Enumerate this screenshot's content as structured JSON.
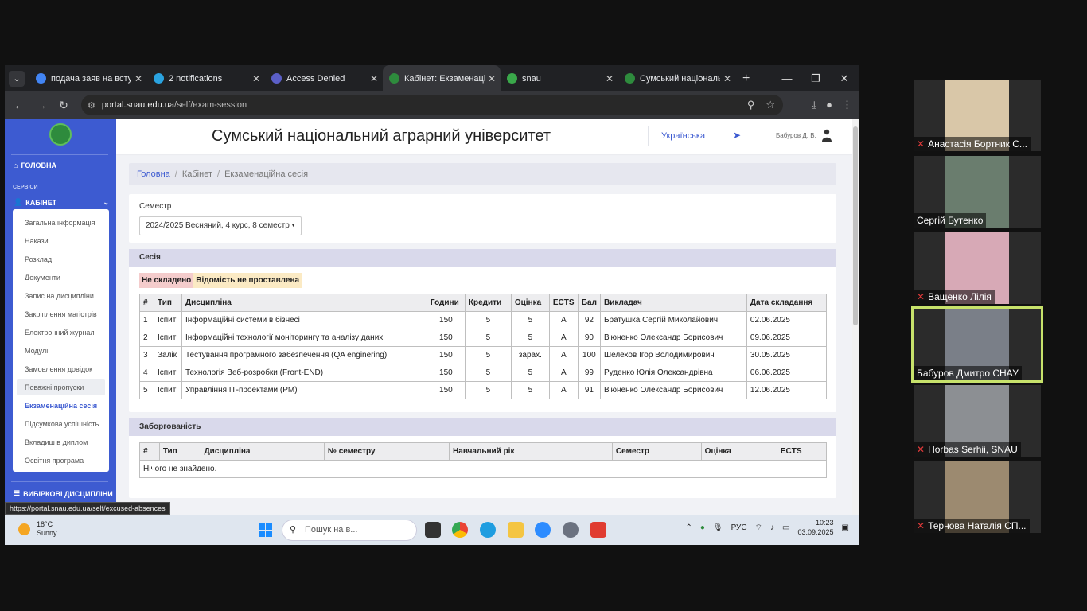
{
  "browser": {
    "tabs": [
      {
        "title": "подача заяв на вступ",
        "favicon": "google-icon",
        "color": "#4285f4"
      },
      {
        "title": "2 notifications",
        "favicon": "telegram-icon",
        "color": "#2aa3e0"
      },
      {
        "title": "Access Denied",
        "favicon": "page-icon",
        "color": "#5b5fc7"
      },
      {
        "title": "Кабінет: Екзаменацій",
        "favicon": "snau-icon",
        "color": "#2e8b3d",
        "active": true
      },
      {
        "title": "snau",
        "favicon": "snau-icon",
        "color": "#3aa84a"
      },
      {
        "title": "Сумський національн",
        "favicon": "snau-leaf-icon",
        "color": "#2e8b3d"
      }
    ],
    "url_host": "portal.snau.edu.ua",
    "url_path": "/self/exam-session",
    "status_url": "https://portal.snau.edu.ua/self/excused-absences"
  },
  "sidebar": {
    "home": "ГОЛОВНА",
    "section": "СЕРВІСИ",
    "cabinet": "КАБІНЕТ",
    "items": [
      "Загальна інформація",
      "Накази",
      "Розклад",
      "Документи",
      "Запис на дисципліни",
      "Закріплення магістрів",
      "Електронний журнал",
      "Модулі",
      "Замовлення довідок",
      "Поважні пропуски",
      "Екзаменаційна сесія",
      "Підсумкова успішність",
      "Вкладиш в диплом",
      "Освітня програма"
    ],
    "hover_index": 9,
    "active_index": 10,
    "electives": "ВИБІРКОВІ ДИСЦИПЛІНИ"
  },
  "header": {
    "title": "Сумський національний аграрний університет",
    "language": "Українська",
    "user": "Бабуров Д. В."
  },
  "breadcrumb": {
    "home": "Головна",
    "cabinet": "Кабінет",
    "current": "Екзаменаційна сесія"
  },
  "semester": {
    "label": "Семестр",
    "value": "2024/2025 Весняний, 4 курс, 8 семестр"
  },
  "session": {
    "title": "Сесія",
    "legend_failed": "Не складено",
    "legend_no_sheet": "Відомість не проставлена",
    "columns": [
      "#",
      "Тип",
      "Дисципліна",
      "Години",
      "Кредити",
      "Оцінка",
      "ECTS",
      "Бал",
      "Викладач",
      "Дата складання"
    ],
    "rows": [
      [
        "1",
        "Іспит",
        "Інформаційні системи в бізнесі",
        "150",
        "5",
        "5",
        "A",
        "92",
        "Братушка Сергій Миколайович",
        "02.06.2025"
      ],
      [
        "2",
        "Іспит",
        "Інформаційні технології моніторингу та аналізу даних",
        "150",
        "5",
        "5",
        "A",
        "90",
        "В'юненко Олександр Борисович",
        "09.06.2025"
      ],
      [
        "3",
        "Залік",
        "Тестування програмного забезпечення (QA enginering)",
        "150",
        "5",
        "зарах.",
        "A",
        "100",
        "Шелехов Ігор Володимирович",
        "30.05.2025"
      ],
      [
        "4",
        "Іспит",
        "Технологія Веб-розробки (Front-END)",
        "150",
        "5",
        "5",
        "A",
        "99",
        "Руденко Юлія Олександрівна",
        "06.06.2025"
      ],
      [
        "5",
        "Іспит",
        "Управління ІТ-проектами (PM)",
        "150",
        "5",
        "5",
        "A",
        "91",
        "В'юненко Олександр Борисович",
        "12.06.2025"
      ]
    ]
  },
  "debt": {
    "title": "Заборгованість",
    "columns": [
      "#",
      "Тип",
      "Дисципліна",
      "№ семестру",
      "Навчальний рік",
      "Семестр",
      "Оцінка",
      "ECTS"
    ],
    "empty": "Нічого не знайдено."
  },
  "taskbar": {
    "temp": "18°C",
    "weather": "Sunny",
    "search_placeholder": "Пошук на в...",
    "lang": "РУС",
    "time": "10:23",
    "date": "03.09.2025"
  },
  "participants": [
    {
      "name": "Анастасія Бортник С...",
      "muted": true,
      "color": "#d9c7a8"
    },
    {
      "name": "Сергій Бутенко",
      "muted": false,
      "color": "#6a7d6e"
    },
    {
      "name": "Ващенко Лілія",
      "muted": true,
      "color": "#d7a9b6"
    },
    {
      "name": "Бабуров Дмитро СНАУ",
      "muted": false,
      "color": "#7a7f88",
      "active": true
    },
    {
      "name": "Horbas Serhii, SNAU",
      "muted": true,
      "color": "#8c8f93"
    },
    {
      "name": "Тернова Наталія СП...",
      "muted": true,
      "color": "#9c8a70"
    }
  ]
}
